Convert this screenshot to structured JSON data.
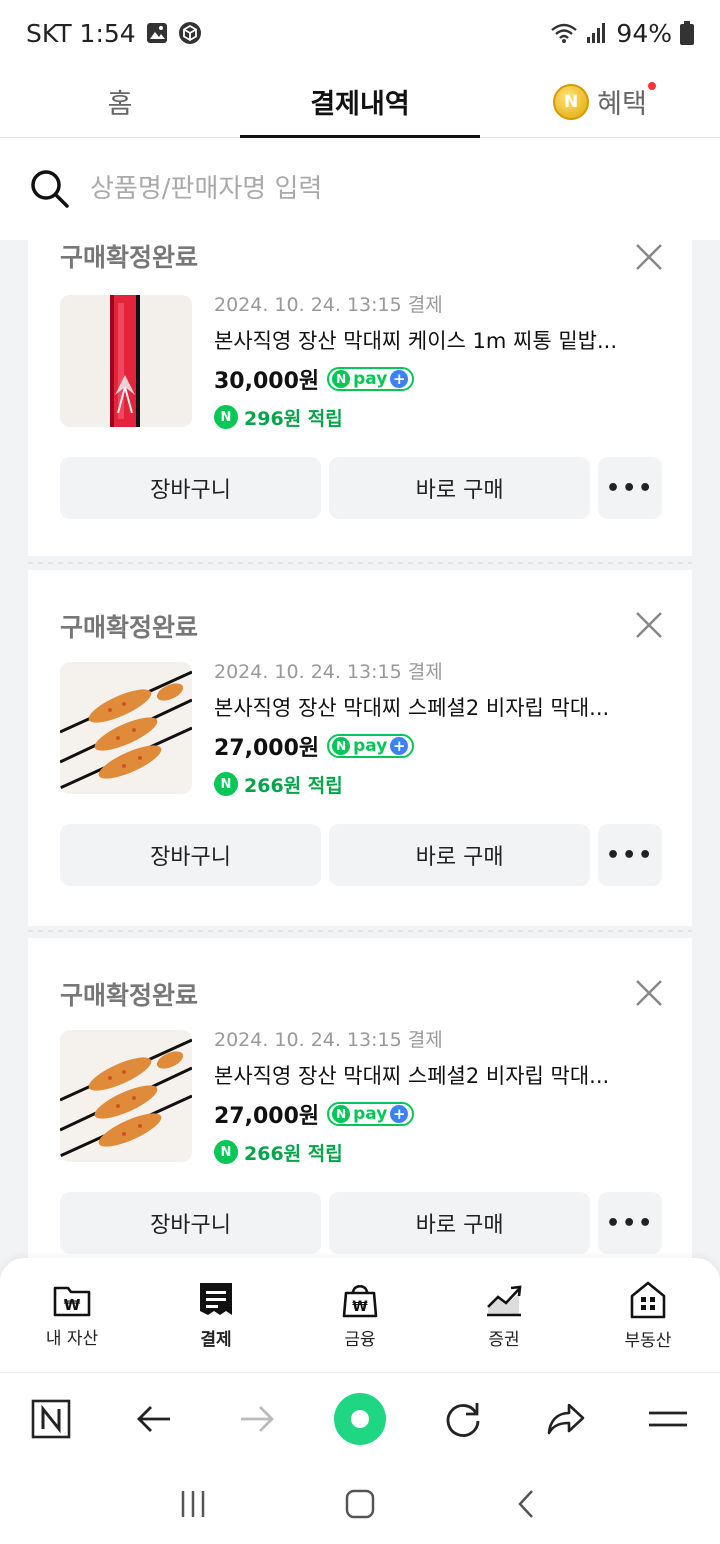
{
  "status_bar": {
    "carrier_time": "SKT 1:54",
    "battery": "94%"
  },
  "top_tabs": [
    {
      "label": "홈"
    },
    {
      "label": "결제내역"
    },
    {
      "label": "혜택"
    }
  ],
  "search": {
    "placeholder": "상품명/판매자명 입력"
  },
  "orders": [
    {
      "status": "구매확정완료",
      "date": "2024. 10. 24. 13:15 결제",
      "title": "본사직영 장산 막대찌 케이스 1m 찌통 밑밥...",
      "price": "30,000원",
      "npay_label": "pay",
      "reward": "296원 적립",
      "cart_label": "장바구니",
      "buy_label": "바로 구매",
      "more_label": "•••"
    },
    {
      "status": "구매확정완료",
      "date": "2024. 10. 24. 13:15 결제",
      "title": "본사직영 장산 막대찌 스페셜2 비자립 막대...",
      "price": "27,000원",
      "npay_label": "pay",
      "reward": "266원 적립",
      "cart_label": "장바구니",
      "buy_label": "바로 구매",
      "more_label": "•••"
    },
    {
      "status": "구매확정완료",
      "date": "2024. 10. 24. 13:15 결제",
      "title": "본사직영 장산 막대찌 스페셜2 비자립 막대...",
      "price": "27,000원",
      "npay_label": "pay",
      "reward": "266원 적립",
      "cart_label": "장바구니",
      "buy_label": "바로 구매",
      "more_label": "•••"
    }
  ],
  "bottom_nav": [
    {
      "label": "내 자산",
      "icon": "wallet-won-icon"
    },
    {
      "label": "결제",
      "icon": "receipt-icon"
    },
    {
      "label": "금융",
      "icon": "bag-won-icon"
    },
    {
      "label": "증권",
      "icon": "chart-up-icon"
    },
    {
      "label": "부동산",
      "icon": "building-icon"
    }
  ],
  "colors": {
    "accent_green": "#06c755",
    "reward_green": "#06a44a",
    "npay_plus_blue": "#3b82f6",
    "fab_green": "#1fd683"
  }
}
